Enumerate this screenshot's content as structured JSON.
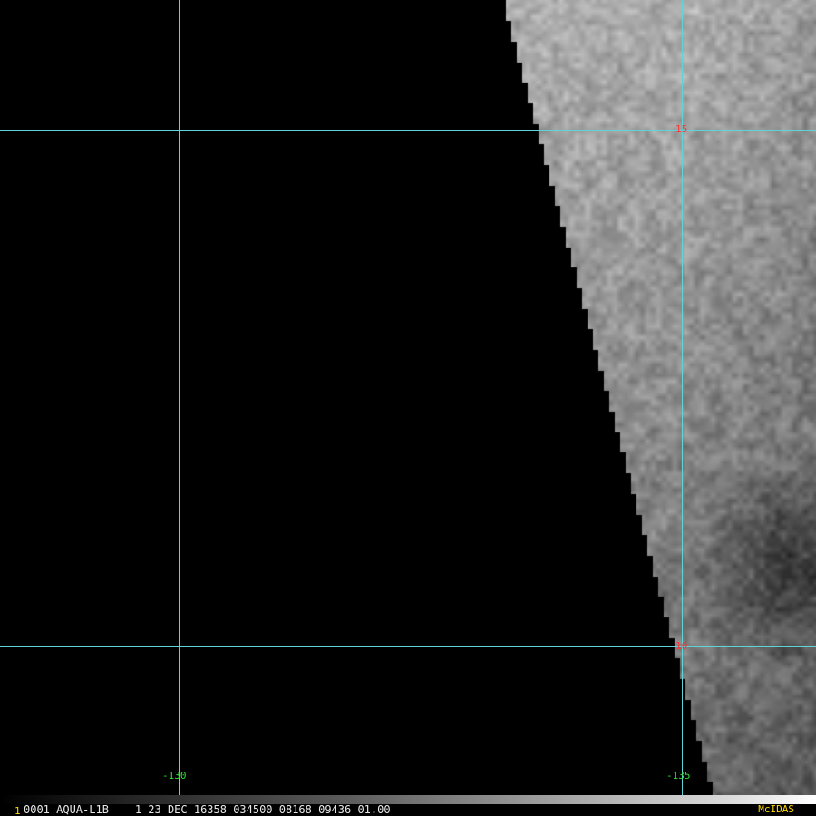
{
  "map": {
    "latitude_labels": [
      "15",
      "10"
    ],
    "longitude_labels": [
      "-130",
      "-135"
    ],
    "colors": {
      "gridline": "#5fd3d8",
      "lat_label": "#ff3333",
      "lon_label": "#33dd33",
      "background": "#000000"
    }
  },
  "status_bar": {
    "frame_number": "1",
    "image_info": "0001 AQUA-L1B    1 23 DEC 16358 034500 08168 09436 01.00",
    "software": "McIDAS"
  }
}
